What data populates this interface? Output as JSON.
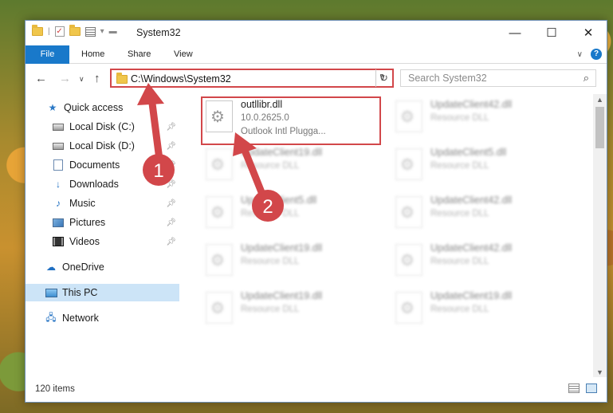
{
  "window": {
    "title": "System32",
    "controls": {
      "minimize": "—",
      "maximize": "☐",
      "close": "✕"
    }
  },
  "ribbon": {
    "tabs": [
      "File",
      "Share",
      "View"
    ],
    "home": "Home"
  },
  "toolbar": {
    "address": "C:\\Windows\\System32",
    "search_placeholder": "Search System32"
  },
  "nav": {
    "quick_access": "Quick access",
    "items": [
      {
        "label": "Local Disk (C:)",
        "icon": "disk-icon"
      },
      {
        "label": "Local Disk (D:)",
        "icon": "disk-icon"
      },
      {
        "label": "Documents",
        "icon": "documents-icon"
      },
      {
        "label": "Downloads",
        "icon": "downloads-icon"
      },
      {
        "label": "Music",
        "icon": "music-icon"
      },
      {
        "label": "Pictures",
        "icon": "pictures-icon"
      },
      {
        "label": "Videos",
        "icon": "videos-icon"
      }
    ],
    "onedrive": "OneDrive",
    "thispc": "This PC",
    "network": "Network"
  },
  "files": {
    "main": {
      "name": "outllibr.dll",
      "version": "10.0.2625.0",
      "description": "Outlook Intl Plugga..."
    },
    "blurred": [
      {
        "name": "UpdateClient42.dll",
        "desc": "Resource DLL"
      },
      {
        "name": "UpdateClient19.dll",
        "desc": "Resource DLL"
      },
      {
        "name": "UpdateClient5.dll",
        "desc": "Resource DLL"
      },
      {
        "name": "UpdateClient5.dll",
        "desc": "Resource DLL"
      },
      {
        "name": "UpdateClient42.dll",
        "desc": "Resource DLL"
      },
      {
        "name": "UpdateClient19.dll",
        "desc": "Resource DLL"
      },
      {
        "name": "UpdateClient42.dll",
        "desc": "Resource DLL"
      },
      {
        "name": "UpdateClient19.dll",
        "desc": "Resource DLL"
      },
      {
        "name": "UpdateClient19.dll",
        "desc": "Resource DLL"
      }
    ]
  },
  "status": {
    "item_count": "120 items"
  },
  "annotations": {
    "step1": "1",
    "step2": "2",
    "color": "#d2474a"
  }
}
